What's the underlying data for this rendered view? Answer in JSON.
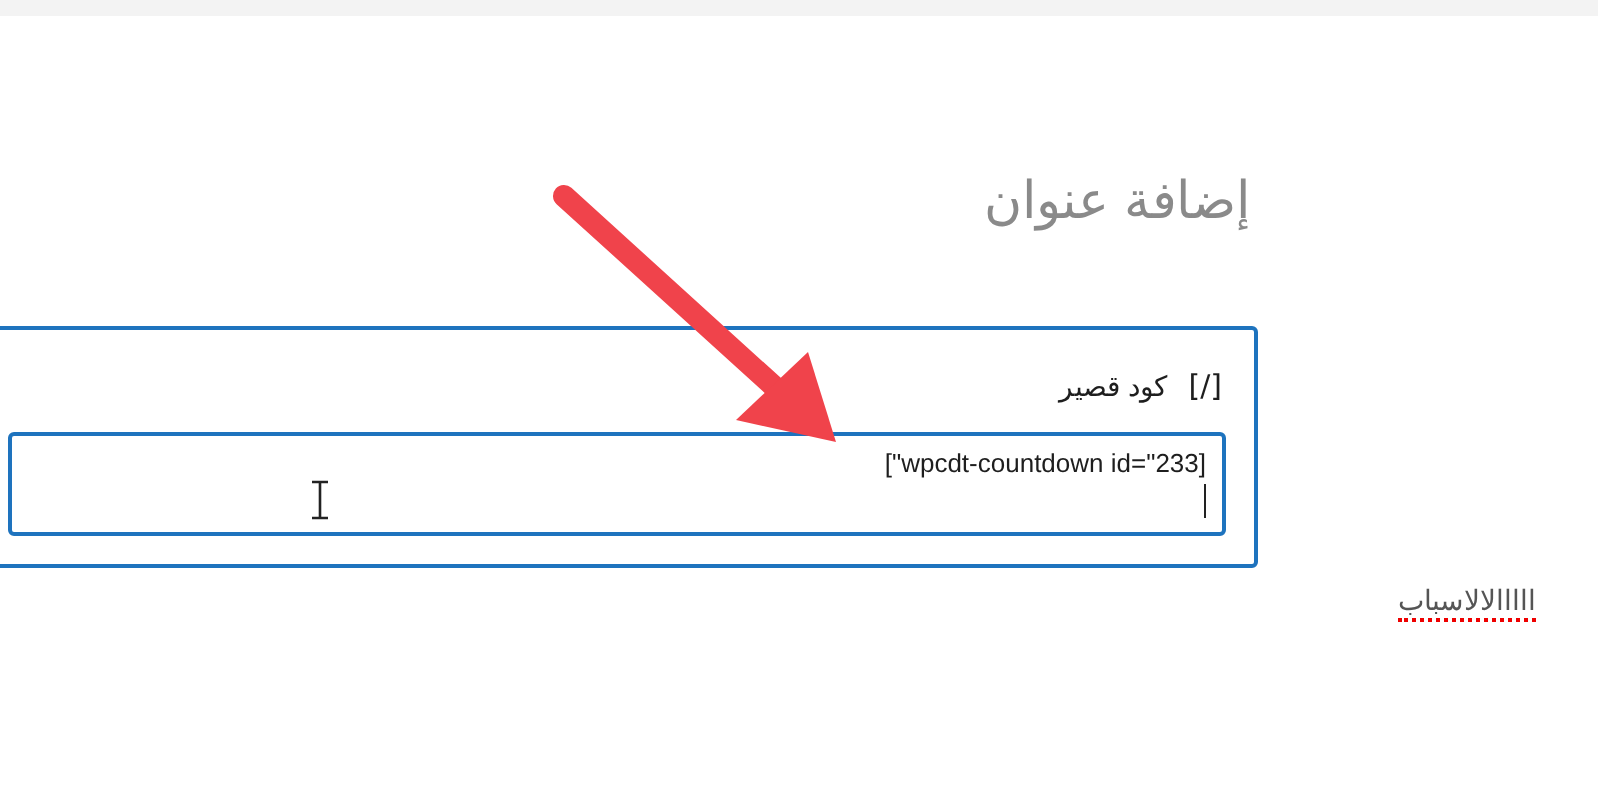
{
  "title_placeholder": "إضافة عنوان",
  "shortcode_block": {
    "icon": "[/]",
    "label": "كود قصير",
    "value": "[\"wpcdt-countdown id=\"233]"
  },
  "paragraph": {
    "text": "ااااالالاسباب",
    "misspelled": true
  }
}
